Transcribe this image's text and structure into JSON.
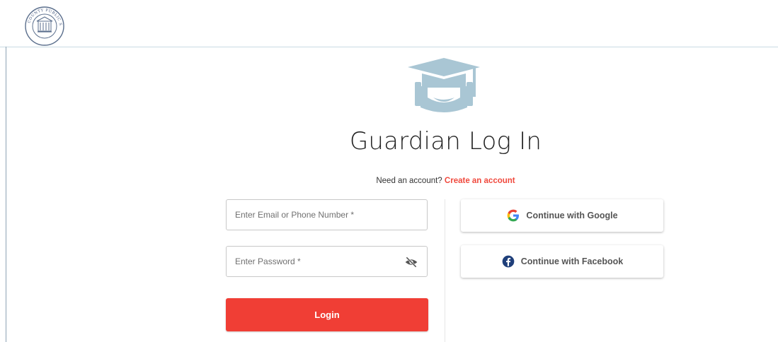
{
  "colors": {
    "accent": "#f03e35",
    "link": "#f0493d",
    "hero_icon": "#a9c6d4",
    "facebook": "#1f3f7a"
  },
  "header": {
    "logo": "fayette-county-public-schools-seal",
    "logo_text": "FAYETTE COUNTY PUBLIC SCHOOLS"
  },
  "hero": {
    "icon": "graduate-cap-icon",
    "title": "Guardian Log In"
  },
  "account": {
    "prompt": "Need an account?",
    "link_label": "Create an account"
  },
  "form": {
    "email_placeholder": "Enter Email or Phone Number *",
    "email_value": "",
    "password_placeholder": "Enter Password *",
    "password_value": "",
    "password_toggle_icon": "eye-slash-icon",
    "login_label": "Login"
  },
  "social": {
    "google_label": "Continue with Google",
    "google_icon": "google-icon",
    "facebook_label": "Continue with Facebook",
    "facebook_icon": "facebook-icon"
  }
}
